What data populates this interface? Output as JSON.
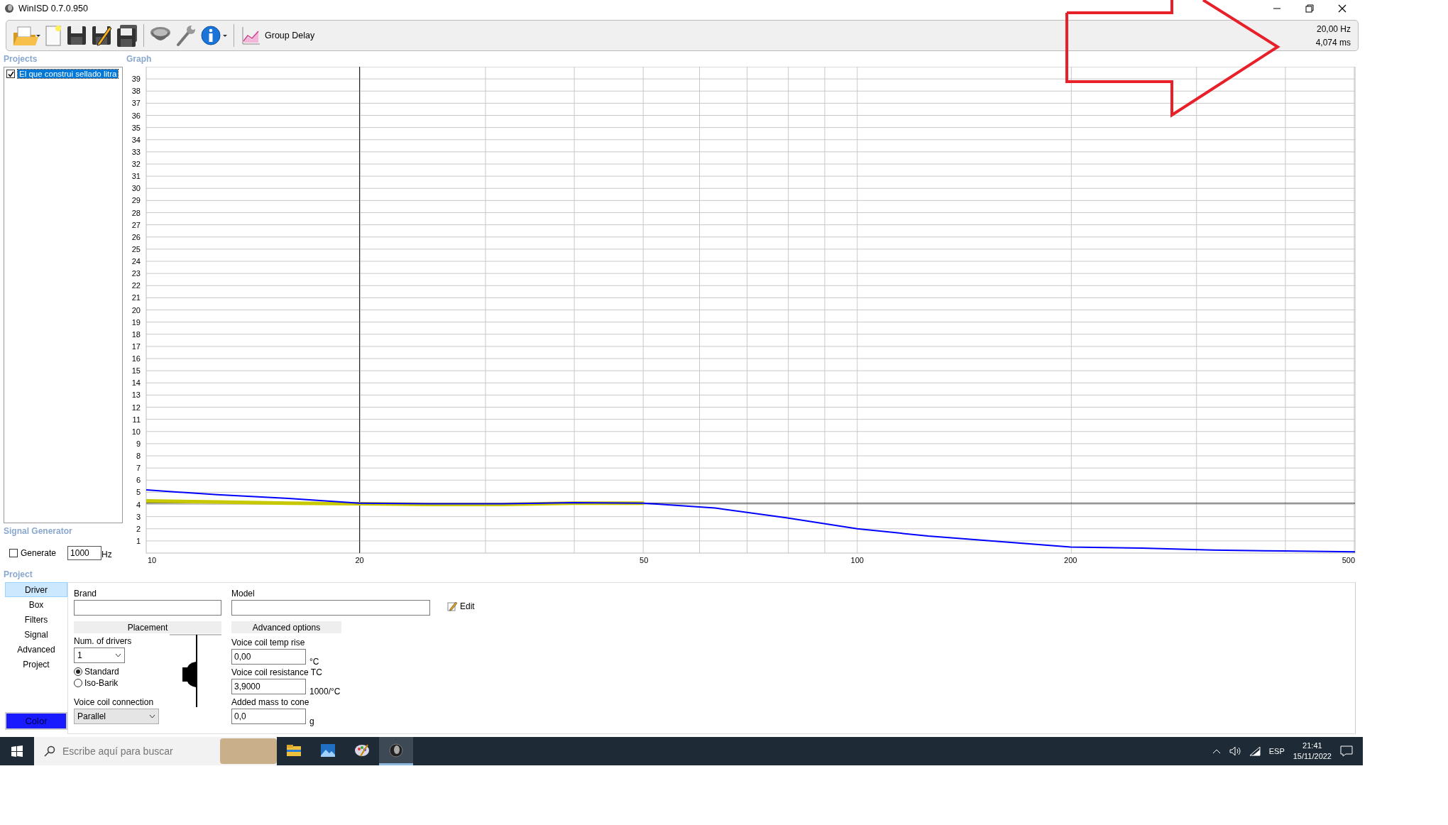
{
  "window": {
    "title": "WinISD 0.7.0.950"
  },
  "toolbar": {
    "graph_type": "Group Delay",
    "readout": [
      "20,00 Hz",
      "4,074 ms"
    ]
  },
  "projects": {
    "label": "Projects",
    "items": [
      {
        "name": "El que construi sellado litra",
        "checked": true,
        "selected": true
      }
    ]
  },
  "graph": {
    "label": "Graph",
    "chart_data": {
      "type": "line",
      "categories": [
        "10",
        null,
        null,
        "20",
        null,
        null,
        null,
        "50",
        null,
        null,
        "100",
        null,
        null,
        "200",
        null,
        null,
        null,
        "500"
      ],
      "series": [
        {
          "color": "#c8c800",
          "values": [
            4.3,
            4.2,
            4.1,
            4.05,
            4.0,
            4.0,
            4.1,
            4.1,
            null,
            null,
            null,
            null,
            null,
            null,
            null,
            null,
            null,
            null
          ]
        },
        {
          "color": "#0000ff",
          "values": [
            5.2,
            4.8,
            4.5,
            4.1,
            4.05,
            4.05,
            4.15,
            4.1,
            3.7,
            2.9,
            2.0,
            1.4,
            0.95,
            0.5,
            0.4,
            0.25,
            0.17,
            0.1
          ]
        }
      ],
      "ylim": [
        0,
        40
      ],
      "yticks": [
        1,
        2,
        3,
        4,
        5,
        6,
        7,
        8,
        9,
        10,
        11,
        12,
        13,
        14,
        15,
        16,
        17,
        18,
        19,
        20,
        21,
        22,
        23,
        24,
        25,
        26,
        27,
        28,
        29,
        30,
        31,
        32,
        33,
        34,
        35,
        36,
        37,
        38,
        39
      ],
      "grid": true
    }
  },
  "signal_generator": {
    "label": "Signal Generator",
    "generate": {
      "label": "Generate",
      "checked": false
    },
    "frequency": "1000",
    "unit": "Hz"
  },
  "project": {
    "label": "Project",
    "tabs": [
      {
        "label": "Driver",
        "selected": true
      },
      {
        "label": "Box",
        "selected": false
      },
      {
        "label": "Filters",
        "selected": false
      },
      {
        "label": "Signal",
        "selected": false
      },
      {
        "label": "Advanced",
        "selected": false
      },
      {
        "label": "Project",
        "selected": false
      }
    ],
    "color_button": "Color",
    "fields": [
      {
        "label": "Brand"
      },
      {
        "label": "Model"
      }
    ],
    "edit_button": "Edit",
    "placement": {
      "heading": "Placement",
      "num_drivers_label": "Num. of drivers",
      "num_drivers": "1",
      "options": [
        {
          "label": "Standard",
          "selected": true
        },
        {
          "label": "Iso-Barik",
          "selected": false
        }
      ],
      "connection_label": "Voice coil connection",
      "connection": "Parallel"
    },
    "advanced": {
      "heading": "Advanced options",
      "fields": [
        {
          "label": "Voice coil temp rise",
          "value": "0,00",
          "unit": "°C"
        },
        {
          "label": "Voice coil resistance TC",
          "value": "3,9000",
          "unit": "1000/°C"
        },
        {
          "label": "Added mass to cone",
          "value": "0,0",
          "unit": "g"
        }
      ]
    }
  },
  "taskbar": {
    "search_placeholder": "Escribe aquí para buscar",
    "apps": [
      {
        "kind": "files",
        "selected": false
      },
      {
        "kind": "photos",
        "selected": false
      },
      {
        "kind": "paint",
        "selected": false
      },
      {
        "kind": "speaker",
        "selected": true
      }
    ],
    "language": "ESP",
    "time": "21:41",
    "date": "15/11/2022"
  }
}
